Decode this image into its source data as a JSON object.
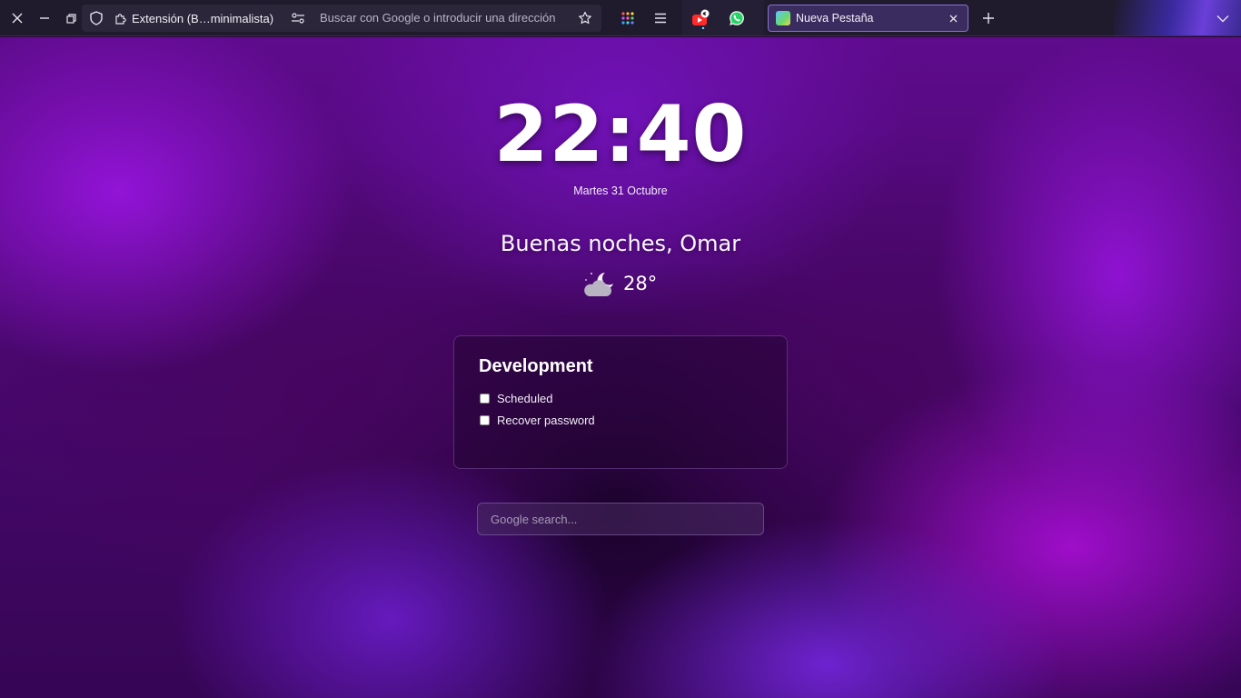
{
  "browser": {
    "url_bar": {
      "extension_label": "Extensión (B…minimalista)",
      "placeholder": "Buscar con Google o introducir una dirección"
    },
    "tab": {
      "title": "Nueva Pestaña"
    },
    "icons": [
      "close-icon",
      "minimize-icon",
      "restore-icon",
      "shield-icon",
      "extension-icon",
      "permissions-icon",
      "star-icon",
      "apps-grid-icon",
      "menu-icon",
      "youtube-icon",
      "whatsapp-icon",
      "tab-close-icon",
      "new-tab-icon",
      "chevron-down-icon"
    ]
  },
  "newtab": {
    "time": "22:40",
    "date": "Martes 31 Octubre",
    "greeting": "Buenas noches, Omar",
    "weather": {
      "icon": "night-cloudy-icon",
      "temperature": "28°"
    },
    "todo": {
      "title": "Development",
      "items": [
        {
          "label": "Scheduled",
          "checked": false
        },
        {
          "label": "Recover password",
          "checked": false
        }
      ]
    },
    "search": {
      "placeholder": "Google search..."
    }
  },
  "colors": {
    "toolbar_bg": "#1f1b2c",
    "accent": "#8a6fd6",
    "background_purple": "#5e0b8c"
  }
}
